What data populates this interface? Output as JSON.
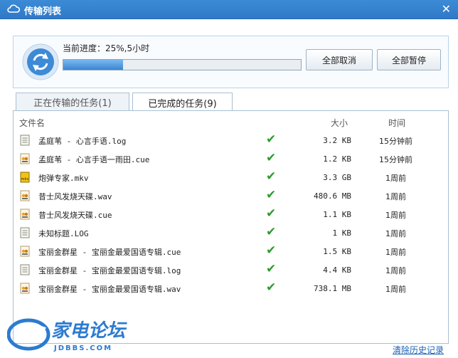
{
  "window": {
    "title": "传输列表",
    "close_symbol": "✕"
  },
  "progress": {
    "label": "当前进度：25%,5小时",
    "fraction": 0.25
  },
  "buttons": {
    "cancel_all": "全部取消",
    "pause_all": "全部暂停"
  },
  "tabs": [
    {
      "label": "正在传输的任务(1)",
      "active": false
    },
    {
      "label": "已完成的任务(9)",
      "active": true
    }
  ],
  "table": {
    "headers": {
      "name": "文件名",
      "size": "大小",
      "time": "时间"
    },
    "rows": [
      {
        "icon": "document-icon",
        "name": "孟庭苇 - 心言手语.log",
        "size": "3.2 KB",
        "time": "15分钟前"
      },
      {
        "icon": "audio-file-icon",
        "name": "孟庭苇 - 心言手语一雨田.cue",
        "size": "1.2 KB",
        "time": "15分钟前"
      },
      {
        "icon": "video-file-icon",
        "name": "炮弹专家.mkv",
        "size": "3.3 GB",
        "time": "1周前"
      },
      {
        "icon": "audio-file-icon",
        "name": "昔士风发烧天碟.wav",
        "size": "480.6 MB",
        "time": "1周前"
      },
      {
        "icon": "audio-file-icon",
        "name": "昔士风发烧天碟.cue",
        "size": "1.1 KB",
        "time": "1周前"
      },
      {
        "icon": "document-icon",
        "name": "未知标题.LOG",
        "size": "1 KB",
        "time": "1周前"
      },
      {
        "icon": "audio-file-icon",
        "name": "宝丽金群星 - 宝丽金最爱国语专辑.cue",
        "size": "1.5 KB",
        "time": "1周前"
      },
      {
        "icon": "document-icon",
        "name": "宝丽金群星 - 宝丽金最爱国语专辑.log",
        "size": "4.4 KB",
        "time": "1周前"
      },
      {
        "icon": "audio-file-icon",
        "name": "宝丽金群星 - 宝丽金最爱国语专辑.wav",
        "size": "738.1 MB",
        "time": "1周前"
      }
    ]
  },
  "footer": {
    "clear_history": "清除历史记录"
  },
  "watermark": {
    "brand": "家电论坛",
    "site": "JDBBS.COM"
  },
  "colors": {
    "titlebar": "#2f79c8",
    "progress_fill": "#3c86d2",
    "check": "#2f9a2f",
    "link": "#1b5fb4"
  }
}
